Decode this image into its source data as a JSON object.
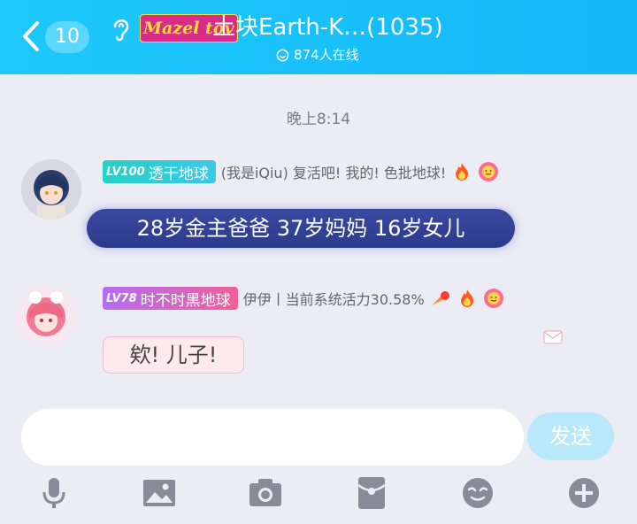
{
  "header": {
    "back_count": "10",
    "sticker_text": "Mazel tov",
    "title": "土块Earth-K…",
    "member_count": "(1035)",
    "online": "874人在线"
  },
  "chat": {
    "timestamp": "晚上8:14",
    "messages": [
      {
        "level": "LV100",
        "badge": "透干地球",
        "nickname": "(我是iQiu) 复活吧! 我的! 色批地球!",
        "text": "28岁金主爸爸 37岁妈妈 16岁女儿"
      },
      {
        "level": "LV78",
        "badge": "时不时黑地球",
        "nickname": "伊伊丨当前系统活力30.58%",
        "text": "欸! 儿子!"
      }
    ]
  },
  "composer": {
    "placeholder": "",
    "send_label": "发送"
  },
  "toolbar": [
    "microphone-icon",
    "image-icon",
    "camera-icon",
    "red-packet-icon",
    "emoji-icon",
    "plus-icon"
  ],
  "colors": {
    "header": "#14b8f8",
    "badge1": "#2fd0c0",
    "badge2": "#f0609a"
  }
}
